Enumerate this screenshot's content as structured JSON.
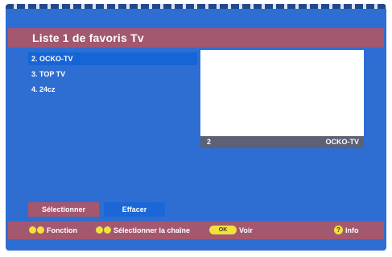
{
  "title": "Liste 1 de favoris Tv",
  "channels": [
    {
      "label": "2. OCKO-TV",
      "selected": true
    },
    {
      "label": "3. TOP TV",
      "selected": false
    },
    {
      "label": "4. 24cz",
      "selected": false
    }
  ],
  "preview": {
    "number": "2",
    "name": "OCKO-TV"
  },
  "buttons": {
    "select": "Sélectionner",
    "delete": "Effacer"
  },
  "hints": {
    "function": "Fonction",
    "select_channel": "Sélectionner la chaîne",
    "ok": "OK",
    "view": "Voir",
    "info_icon": "?",
    "info": "Info"
  },
  "colors": {
    "background": "#2e6ed2",
    "accent": "#a3586f",
    "selected": "#1565d6",
    "hint_icon": "#f2e13a"
  },
  "icons": [
    "left-right-arrows-icon",
    "up-down-arrows-icon",
    "ok-button-icon",
    "help-icon"
  ]
}
